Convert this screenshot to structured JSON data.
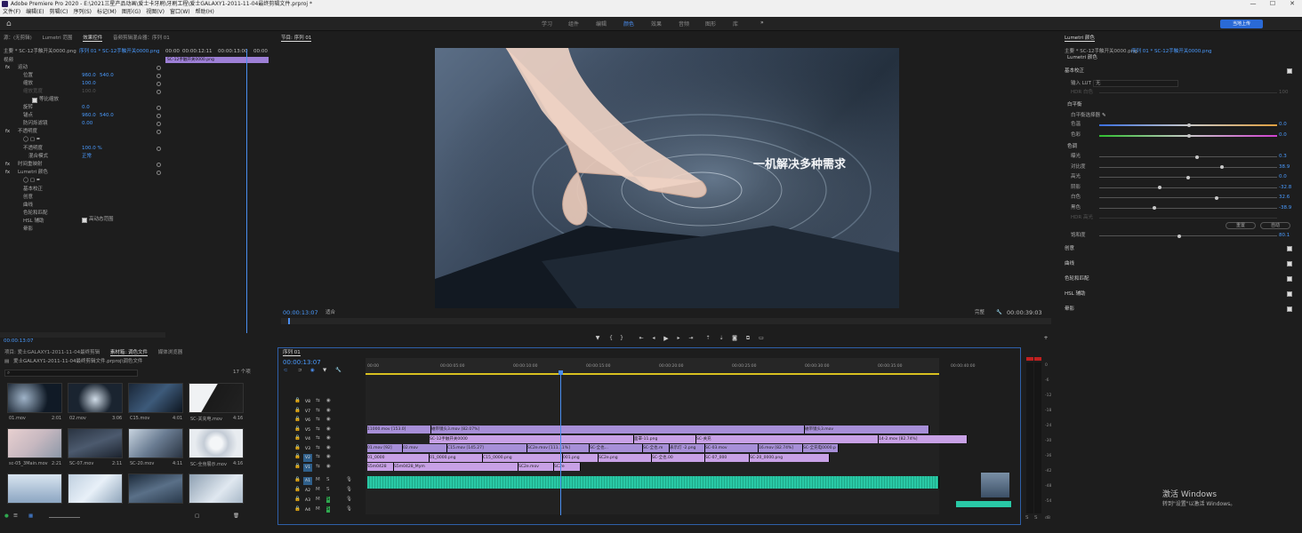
{
  "titlebar": {
    "title": "Adobe Premiere Pro 2020 - E:\\2021三星产品动画\\爱士卡牙刷\\牙刷工程\\爱士GALAXY1-2011-11-04最终剪辑文件.prproj *",
    "min": "—",
    "max": "☐",
    "close": "✕"
  },
  "menu": [
    "文件(F)",
    "编辑(E)",
    "剪辑(C)",
    "序列(S)",
    "标记(M)",
    "图形(G)",
    "视图(V)",
    "窗口(W)",
    "帮助(H)"
  ],
  "workspaces": [
    "学习",
    "组件",
    "编辑",
    "颜色",
    "效果",
    "音频",
    "图形",
    "库"
  ],
  "active_workspace": "颜色",
  "more": "»",
  "share_label": "当地上传",
  "effect_controls": {
    "tabs": [
      "源：(无剪辑)",
      "Lumetri 范围",
      "效果控件",
      "音频剪辑混合器：序列 01"
    ],
    "active_tab": "效果控件",
    "master": "主要 * SC-12手触开关0000.png",
    "seq": "序列 01 * SC-12手触开关0000.png",
    "section": "视频",
    "mini_times": [
      "00:00",
      "00:00:12:11",
      "00:00:13:00",
      "00:00"
    ],
    "clipname": "SC-12手触开关0000.png",
    "rows": [
      {
        "label": "运动",
        "indent": 1,
        "fx": true
      },
      {
        "label": "位置",
        "indent": 2,
        "v1": "960.0",
        "v2": "540.0"
      },
      {
        "label": "缩放",
        "indent": 2,
        "v1": "100.0"
      },
      {
        "label": "缩放宽度",
        "indent": 2,
        "v1": "100.0",
        "dim": true
      },
      {
        "label": "等比缩放",
        "indent": 3,
        "check": true
      },
      {
        "label": "旋转",
        "indent": 2,
        "v1": "0.0"
      },
      {
        "label": "锚点",
        "indent": 2,
        "v1": "960.0",
        "v2": "540.0"
      },
      {
        "label": "防闪烁滤镜",
        "indent": 2,
        "v1": "0.00"
      },
      {
        "label": "不透明度",
        "indent": 1,
        "fx": true
      },
      {
        "label": "",
        "indent": 2,
        "shapes": true
      },
      {
        "label": "不透明度",
        "indent": 2,
        "v1": "100.0 %"
      },
      {
        "label": "混合模式",
        "indent": 3,
        "v1": "正常"
      },
      {
        "label": "时间重映射",
        "indent": 1,
        "fx": true
      },
      {
        "label": "Lumetri 颜色",
        "indent": 1,
        "fx": true
      },
      {
        "label": "",
        "indent": 2,
        "shapes": true
      },
      {
        "label": "基本校正",
        "indent": 2
      },
      {
        "label": "创意",
        "indent": 2
      },
      {
        "label": "曲线",
        "indent": 2
      },
      {
        "label": "色轮和匹配",
        "indent": 2
      },
      {
        "label": "HSL 辅助",
        "indent": 2
      },
      {
        "label": "晕影",
        "indent": 2
      }
    ],
    "high_range": "高动态范围",
    "timecode": "00:00:13:07"
  },
  "program": {
    "title": "节目: 序列 01",
    "overlay_text": "一机解决多种需求",
    "timecode": "00:00:13:07",
    "fit": "适合",
    "quality": "完整",
    "duration": "00:00:39:03"
  },
  "project": {
    "tabs": [
      "项目: 爱士GALAXY1-2011-11-04最终剪辑",
      "素材箱: 调色文件",
      "媒体浏览器"
    ],
    "active_tab": "素材箱: 调色文件",
    "path": "爱士GALAXY1-2011-11-04最终剪辑文件.prproj\\调色文件",
    "count": "17 个项",
    "items": [
      {
        "name": "01.mov",
        "dur": "2:01"
      },
      {
        "name": "02.mov",
        "dur": "3:06"
      },
      {
        "name": "C15.mov",
        "dur": "4:01"
      },
      {
        "name": "SC-关充电.mov",
        "dur": "4:16"
      },
      {
        "name": "sc-05_3Main.mov",
        "dur": "2:21"
      },
      {
        "name": "SC-07.mov",
        "dur": "2:11"
      },
      {
        "name": "SC-20.mov",
        "dur": "4:11"
      },
      {
        "name": "SC-全身展示.mov",
        "dur": "4:16"
      },
      {
        "name": "",
        "dur": ""
      },
      {
        "name": "",
        "dur": ""
      },
      {
        "name": "",
        "dur": ""
      },
      {
        "name": "",
        "dur": ""
      }
    ]
  },
  "timeline": {
    "title": "序列 01",
    "timecode": "00:00:13:07",
    "ruler": [
      "00:00",
      "00:00:05:00",
      "00:00:10:00",
      "00:00:15:00",
      "00:00:20:00",
      "00:00:25:00",
      "00:00:30:00",
      "00:00:35:00",
      "00:00:40:00"
    ],
    "tracks": [
      {
        "id": "V8",
        "kind": "v"
      },
      {
        "id": "V7",
        "kind": "v"
      },
      {
        "id": "V6",
        "kind": "v"
      },
      {
        "id": "V5",
        "kind": "v"
      },
      {
        "id": "V4",
        "kind": "v"
      },
      {
        "id": "V3",
        "kind": "v"
      },
      {
        "id": "V2",
        "kind": "v"
      },
      {
        "id": "V1",
        "kind": "v"
      },
      {
        "id": "A1",
        "kind": "a"
      },
      {
        "id": "A2",
        "kind": "a"
      },
      {
        "id": "A3",
        "kind": "a"
      },
      {
        "id": "A4",
        "kind": "a"
      }
    ],
    "clips_v5": [
      "11000.mov [153.0]",
      "磁带镜头3.mov [82.07%]",
      "磁带镜头3.mov"
    ],
    "clips_v4": [
      "SC-12手触开关0000",
      "面罩-11.png",
      "SC-关充",
      "14-2.mov [82.74%]"
    ],
    "clips_v3": [
      "01.mov [92]",
      "02.mov",
      "C15.mov [145.27]",
      "SC2e.mov [111.11%]",
      "SC-全也...",
      "SC-全也.m",
      "表示灯 -2.png",
      "SC-03.mov",
      "16.mov [82.74%]",
      "SC-全充电0000.p"
    ],
    "clips_v2": [
      "01_0000",
      "01_0000.png",
      "C15_0000.png",
      "001.png",
      "SC2e.png",
      "SC-全也.00",
      "SC-07_000",
      "SC-20_0000.png"
    ],
    "clips_v1": [
      "S5m0428",
      "S5m0428_Mym",
      "SC2e.mov",
      "SC2e"
    ]
  },
  "meter": {
    "ticks": [
      "0",
      "-6",
      "-12",
      "-18",
      "-24",
      "-30",
      "-36",
      "-42",
      "-48",
      "-54"
    ],
    "unit": "dB"
  },
  "lumetri": {
    "title": "Lumetri 颜色",
    "master": "主要 * SC-12手触开关0000.png",
    "seq": "序列 01 * SC-12手触开关0000.png",
    "fx": "Lumetri 颜色",
    "basic": "基本校正",
    "input_lut_label": "输入 LUT",
    "input_lut_value": "无",
    "hdr_label": "HDR 白色",
    "hdr_value": "100",
    "wb": "白平衡",
    "wb_picker": "白平衡选择器",
    "temp_label": "色温",
    "temp_value": "0.0",
    "tint_label": "色彩",
    "tint_value": "0.0",
    "tone": "色调",
    "sliders": [
      {
        "label": "曝光",
        "value": "0.3",
        "pos": 0.55
      },
      {
        "label": "对比度",
        "value": "38.9",
        "pos": 0.69
      },
      {
        "label": "高光",
        "value": "0.0",
        "pos": 0.5
      },
      {
        "label": "阴影",
        "value": "-32.8",
        "pos": 0.34
      },
      {
        "label": "白色",
        "value": "32.6",
        "pos": 0.66
      },
      {
        "label": "黑色",
        "value": "-38.9",
        "pos": 0.31
      },
      {
        "label": "HDR 高光",
        "value": "",
        "pos": 0.5
      }
    ],
    "reset": "重置",
    "auto": "自动",
    "saturation_label": "饱和度",
    "saturation_value": "80.1",
    "saturation_pos": 0.45,
    "sections": [
      "创意",
      "曲线",
      "色轮和匹配",
      "HSL 辅助",
      "晕影"
    ]
  },
  "watermark": {
    "line1": "激活 Windows",
    "line2": "转到\"设置\"以激活 Windows。"
  }
}
